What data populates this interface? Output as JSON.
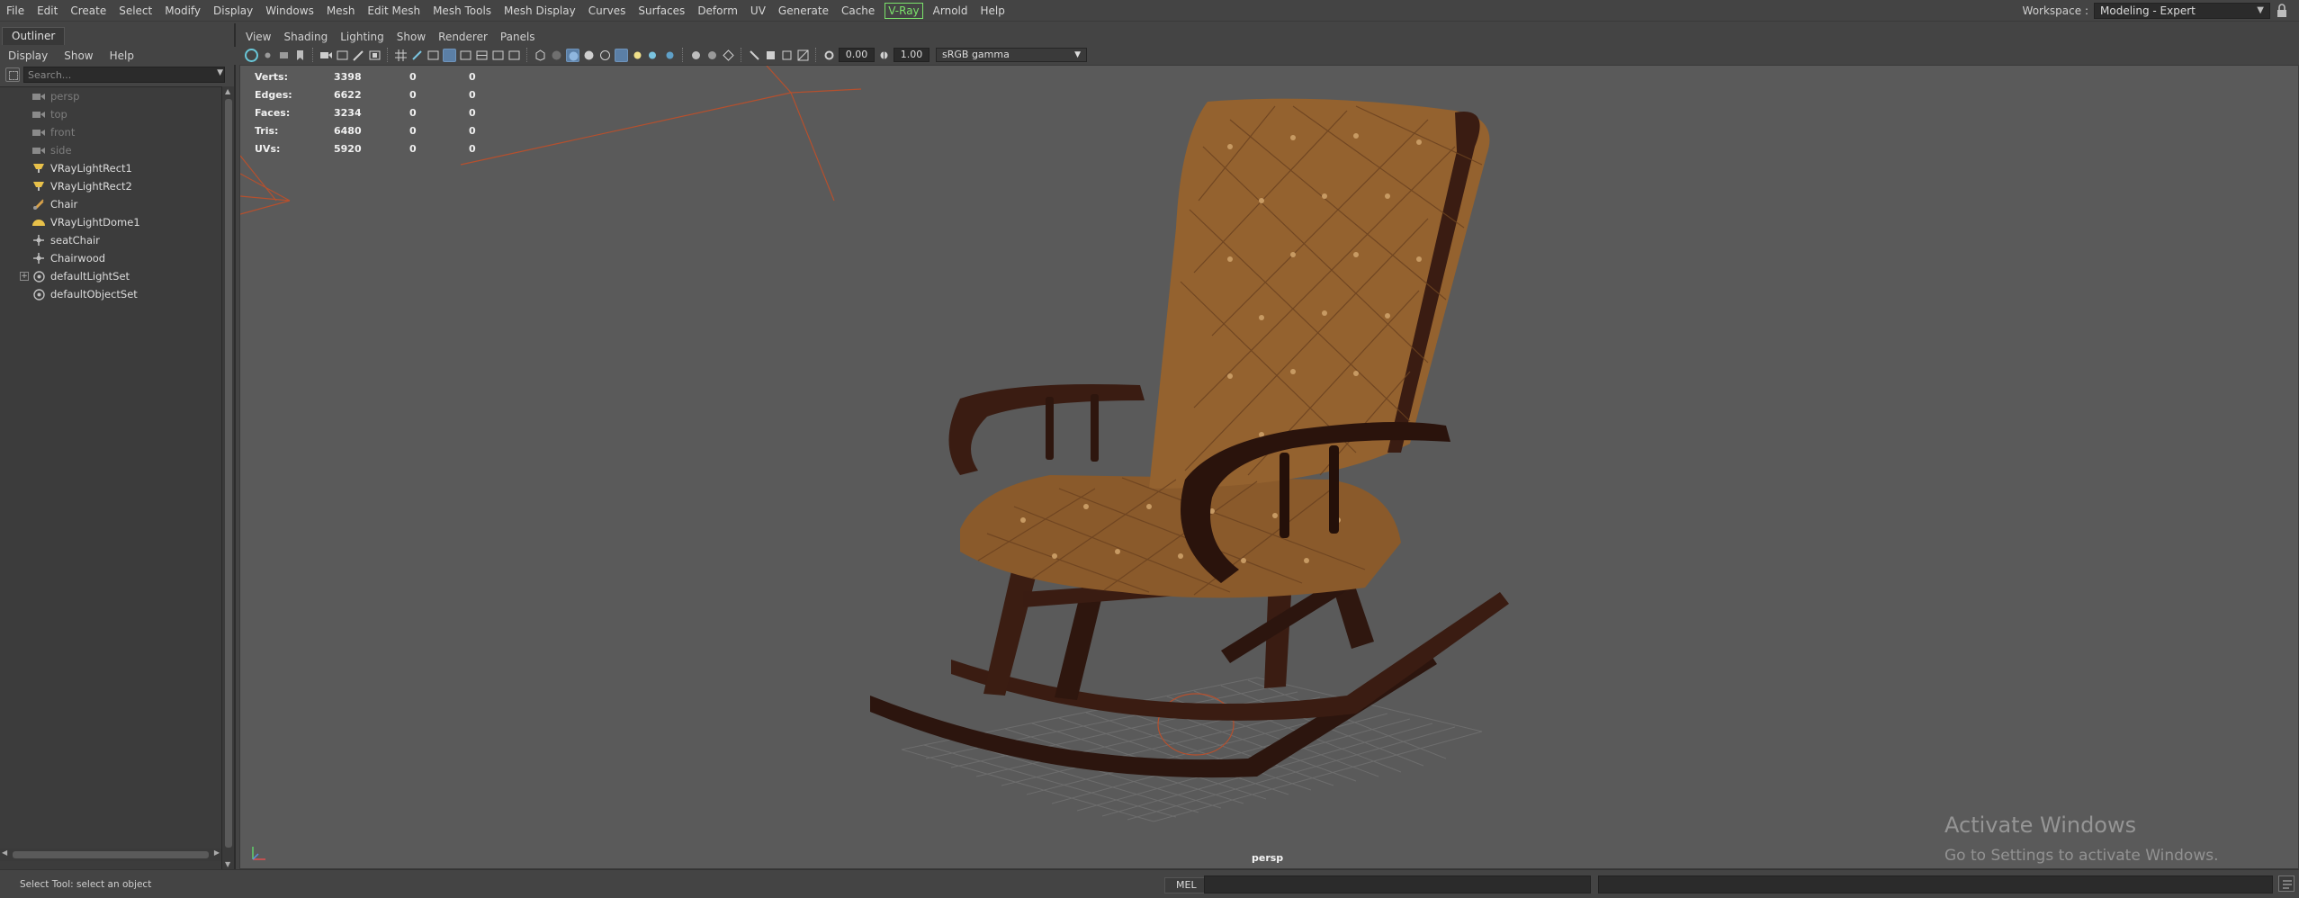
{
  "menubar": {
    "items": [
      "File",
      "Edit",
      "Create",
      "Select",
      "Modify",
      "Display",
      "Windows",
      "Mesh",
      "Edit Mesh",
      "Mesh Tools",
      "Mesh Display",
      "Curves",
      "Surfaces",
      "Deform",
      "UV",
      "Generate",
      "Cache",
      "V-Ray",
      "Arnold",
      "Help"
    ],
    "vray_item": "V-Ray",
    "workspace_label": "Workspace :",
    "workspace_value": "Modeling - Expert"
  },
  "outliner": {
    "tab": "Outliner",
    "menu": [
      "Display",
      "Show",
      "Help"
    ],
    "search_placeholder": "Search...",
    "items": [
      {
        "label": "persp",
        "icon": "camera-icon",
        "dim": true
      },
      {
        "label": "top",
        "icon": "camera-icon",
        "dim": true
      },
      {
        "label": "front",
        "icon": "camera-icon",
        "dim": true
      },
      {
        "label": "side",
        "icon": "camera-icon",
        "dim": true
      },
      {
        "label": "VRayLightRect1",
        "icon": "rect-light-icon",
        "dim": false
      },
      {
        "label": "VRayLightRect2",
        "icon": "rect-light-icon",
        "dim": false
      },
      {
        "label": "Chair",
        "icon": "mesh-icon",
        "dim": false
      },
      {
        "label": "VRayLightDome1",
        "icon": "dome-light-icon",
        "dim": false
      },
      {
        "label": "seatChair",
        "icon": "transform-icon",
        "dim": false
      },
      {
        "label": "Chairwood",
        "icon": "transform-icon",
        "dim": false
      },
      {
        "label": "defaultLightSet",
        "icon": "set-icon",
        "dim": false,
        "expandable": true
      },
      {
        "label": "defaultObjectSet",
        "icon": "set-icon",
        "dim": false
      }
    ]
  },
  "viewport": {
    "menu": [
      "View",
      "Shading",
      "Lighting",
      "Show",
      "Renderer",
      "Panels"
    ],
    "exposure": "0.00",
    "gamma": "1.00",
    "color_space": "sRGB gamma",
    "camera": "persp",
    "hud": {
      "rows": [
        {
          "label": "Verts:",
          "value": "3398",
          "c1": "0",
          "c2": "0"
        },
        {
          "label": "Edges:",
          "value": "6622",
          "c1": "0",
          "c2": "0"
        },
        {
          "label": "Faces:",
          "value": "3234",
          "c1": "0",
          "c2": "0"
        },
        {
          "label": "Tris:",
          "value": "6480",
          "c1": "0",
          "c2": "0"
        },
        {
          "label": "UVs:",
          "value": "5920",
          "c1": "0",
          "c2": "0"
        }
      ]
    }
  },
  "watermark": {
    "line1": "Activate Windows",
    "line2": "Go to Settings to activate Windows."
  },
  "statusbar": {
    "help_text": "Select Tool: select an object",
    "command_language": "MEL"
  },
  "colors": {
    "background": "#444444",
    "viewport_bg": "#5a5a5a",
    "vray_accent": "#7be36b",
    "active_button": "#5b7fa6",
    "leather": "#8a5a2b",
    "wood": "#3a1c12"
  }
}
